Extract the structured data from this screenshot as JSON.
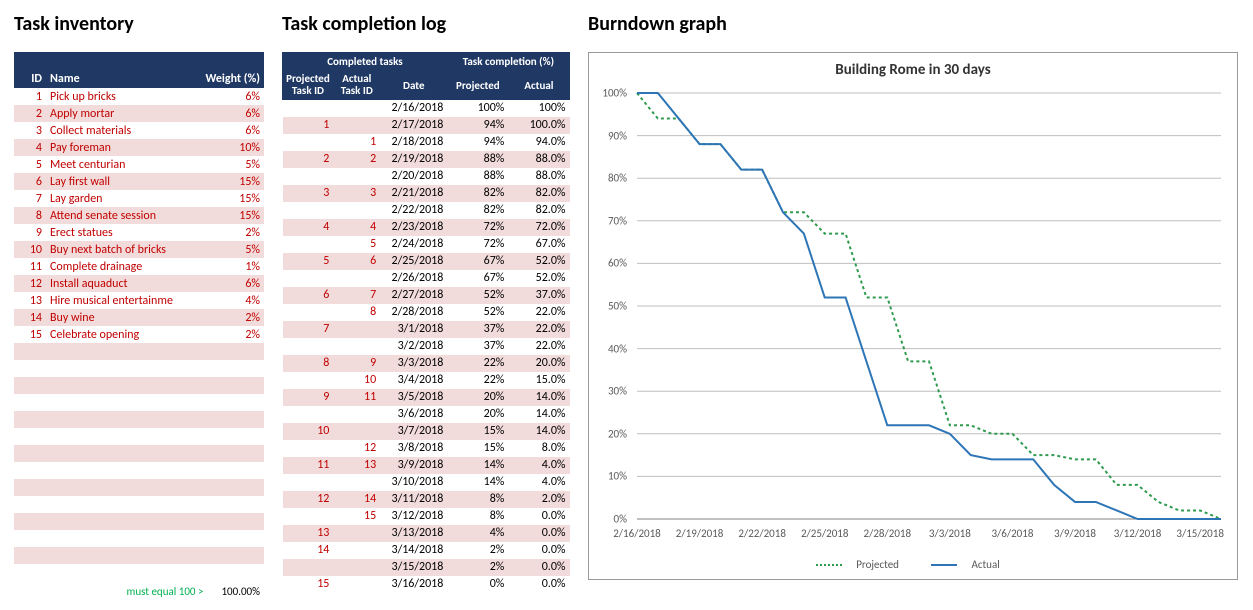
{
  "sections": {
    "inventory_title": "Task inventory",
    "log_title": "Task completion log",
    "chart_title_h": "Burndown graph"
  },
  "inventory": {
    "headers": {
      "id": "ID",
      "name": "Name",
      "weight": "Weight (%)"
    },
    "rows": [
      {
        "id": 1,
        "name": "Pick up bricks",
        "weight": "6%"
      },
      {
        "id": 2,
        "name": "Apply mortar",
        "weight": "6%"
      },
      {
        "id": 3,
        "name": "Collect materials",
        "weight": "6%"
      },
      {
        "id": 4,
        "name": "Pay foreman",
        "weight": "10%"
      },
      {
        "id": 5,
        "name": "Meet centurian",
        "weight": "5%"
      },
      {
        "id": 6,
        "name": "Lay first wall",
        "weight": "15%"
      },
      {
        "id": 7,
        "name": "Lay garden",
        "weight": "15%"
      },
      {
        "id": 8,
        "name": "Attend senate session",
        "weight": "15%"
      },
      {
        "id": 9,
        "name": "Erect statues",
        "weight": "2%"
      },
      {
        "id": 10,
        "name": "Buy next batch of bricks",
        "weight": "5%"
      },
      {
        "id": 11,
        "name": "Complete drainage",
        "weight": "1%"
      },
      {
        "id": 12,
        "name": "Install aquaduct",
        "weight": "6%"
      },
      {
        "id": 13,
        "name": "Hire musical entertainme",
        "weight": "4%"
      },
      {
        "id": 14,
        "name": "Buy wine",
        "weight": "2%"
      },
      {
        "id": 15,
        "name": "Celebrate opening",
        "weight": "2%"
      }
    ],
    "blank_rows": 14,
    "footer": {
      "label": "must equal 100 >",
      "value": "100.00%"
    }
  },
  "log": {
    "headers": {
      "group_tasks": "Completed tasks",
      "group_pct": "Task completion (%)",
      "proj_id": "Projected Task ID",
      "act_id": "Actual Task ID",
      "date": "Date",
      "proj_pct": "Projected",
      "act_pct": "Actual"
    },
    "rows": [
      {
        "pid": "",
        "aid": "",
        "date": "2/16/2018",
        "pp": "100%",
        "ap": "100%"
      },
      {
        "pid": "1",
        "aid": "",
        "date": "2/17/2018",
        "pp": "94%",
        "ap": "100.0%"
      },
      {
        "pid": "",
        "aid": "1",
        "date": "2/18/2018",
        "pp": "94%",
        "ap": "94.0%"
      },
      {
        "pid": "2",
        "aid": "2",
        "date": "2/19/2018",
        "pp": "88%",
        "ap": "88.0%"
      },
      {
        "pid": "",
        "aid": "",
        "date": "2/20/2018",
        "pp": "88%",
        "ap": "88.0%"
      },
      {
        "pid": "3",
        "aid": "3",
        "date": "2/21/2018",
        "pp": "82%",
        "ap": "82.0%"
      },
      {
        "pid": "",
        "aid": "",
        "date": "2/22/2018",
        "pp": "82%",
        "ap": "82.0%"
      },
      {
        "pid": "4",
        "aid": "4",
        "date": "2/23/2018",
        "pp": "72%",
        "ap": "72.0%"
      },
      {
        "pid": "",
        "aid": "5",
        "date": "2/24/2018",
        "pp": "72%",
        "ap": "67.0%"
      },
      {
        "pid": "5",
        "aid": "6",
        "date": "2/25/2018",
        "pp": "67%",
        "ap": "52.0%"
      },
      {
        "pid": "",
        "aid": "",
        "date": "2/26/2018",
        "pp": "67%",
        "ap": "52.0%"
      },
      {
        "pid": "6",
        "aid": "7",
        "date": "2/27/2018",
        "pp": "52%",
        "ap": "37.0%"
      },
      {
        "pid": "",
        "aid": "8",
        "date": "2/28/2018",
        "pp": "52%",
        "ap": "22.0%"
      },
      {
        "pid": "7",
        "aid": "",
        "date": "3/1/2018",
        "pp": "37%",
        "ap": "22.0%"
      },
      {
        "pid": "",
        "aid": "",
        "date": "3/2/2018",
        "pp": "37%",
        "ap": "22.0%"
      },
      {
        "pid": "8",
        "aid": "9",
        "date": "3/3/2018",
        "pp": "22%",
        "ap": "20.0%"
      },
      {
        "pid": "",
        "aid": "10",
        "date": "3/4/2018",
        "pp": "22%",
        "ap": "15.0%"
      },
      {
        "pid": "9",
        "aid": "11",
        "date": "3/5/2018",
        "pp": "20%",
        "ap": "14.0%"
      },
      {
        "pid": "",
        "aid": "",
        "date": "3/6/2018",
        "pp": "20%",
        "ap": "14.0%"
      },
      {
        "pid": "10",
        "aid": "",
        "date": "3/7/2018",
        "pp": "15%",
        "ap": "14.0%"
      },
      {
        "pid": "",
        "aid": "12",
        "date": "3/8/2018",
        "pp": "15%",
        "ap": "8.0%"
      },
      {
        "pid": "11",
        "aid": "13",
        "date": "3/9/2018",
        "pp": "14%",
        "ap": "4.0%"
      },
      {
        "pid": "",
        "aid": "",
        "date": "3/10/2018",
        "pp": "14%",
        "ap": "4.0%"
      },
      {
        "pid": "12",
        "aid": "14",
        "date": "3/11/2018",
        "pp": "8%",
        "ap": "2.0%"
      },
      {
        "pid": "",
        "aid": "15",
        "date": "3/12/2018",
        "pp": "8%",
        "ap": "0.0%"
      },
      {
        "pid": "13",
        "aid": "",
        "date": "3/13/2018",
        "pp": "4%",
        "ap": "0.0%"
      },
      {
        "pid": "14",
        "aid": "",
        "date": "3/14/2018",
        "pp": "2%",
        "ap": "0.0%"
      },
      {
        "pid": "",
        "aid": "",
        "date": "3/15/2018",
        "pp": "2%",
        "ap": "0.0%"
      },
      {
        "pid": "15",
        "aid": "",
        "date": "3/16/2018",
        "pp": "0%",
        "ap": "0.0%"
      }
    ]
  },
  "chart_data": {
    "type": "line",
    "title": "Building Rome in 30 days",
    "xlabel": "",
    "ylabel": "",
    "ylim": [
      0,
      100
    ],
    "y_ticks": [
      0,
      10,
      20,
      30,
      40,
      50,
      60,
      70,
      80,
      90,
      100
    ],
    "x_ticks_every": 3,
    "categories": [
      "2/16/2018",
      "2/17/2018",
      "2/18/2018",
      "2/19/2018",
      "2/20/2018",
      "2/21/2018",
      "2/22/2018",
      "2/23/2018",
      "2/24/2018",
      "2/25/2018",
      "2/26/2018",
      "2/27/2018",
      "2/28/2018",
      "3/1/2018",
      "3/2/2018",
      "3/3/2018",
      "3/4/2018",
      "3/5/2018",
      "3/6/2018",
      "3/7/2018",
      "3/8/2018",
      "3/9/2018",
      "3/10/2018",
      "3/11/2018",
      "3/12/2018",
      "3/13/2018",
      "3/14/2018",
      "3/15/2018",
      "3/16/2018"
    ],
    "series": [
      {
        "name": "Projected",
        "values": [
          100,
          94,
          94,
          88,
          88,
          82,
          82,
          72,
          72,
          67,
          67,
          52,
          52,
          37,
          37,
          22,
          22,
          20,
          20,
          15,
          15,
          14,
          14,
          8,
          8,
          4,
          2,
          2,
          0
        ]
      },
      {
        "name": "Actual",
        "values": [
          100,
          100,
          94,
          88,
          88,
          82,
          82,
          72,
          67,
          52,
          52,
          37,
          22,
          22,
          22,
          20,
          15,
          14,
          14,
          14,
          8,
          4,
          4,
          2,
          0,
          0,
          0,
          0,
          0
        ]
      }
    ],
    "legend": {
      "projected": "Projected",
      "actual": "Actual"
    }
  }
}
